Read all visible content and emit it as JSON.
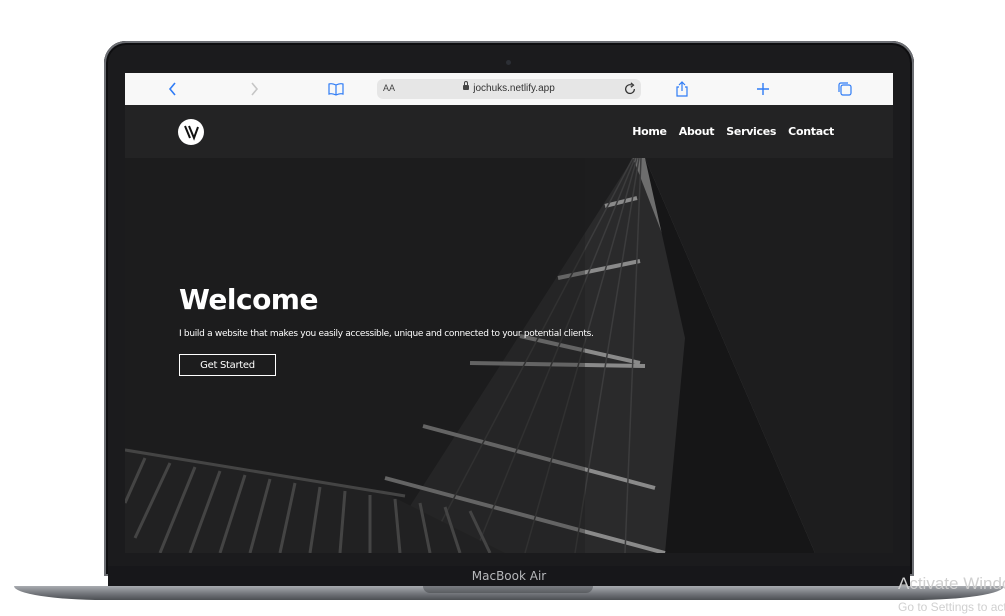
{
  "device": {
    "model_label": "MacBook Air"
  },
  "browser": {
    "address_aa": "AA",
    "url": "jochuks.netlify.app",
    "icons": {
      "back": "chevron-left-icon",
      "forward": "chevron-right-icon",
      "bookmarks": "book-icon",
      "reload": "reload-icon",
      "share": "share-icon",
      "new_tab": "plus-icon",
      "tabs": "tabs-icon"
    },
    "accent": "#2f7cf6"
  },
  "site": {
    "nav": {
      "items": [
        {
          "label": "Home"
        },
        {
          "label": "About"
        },
        {
          "label": "Services"
        },
        {
          "label": "Contact"
        }
      ]
    },
    "hero": {
      "title": "Welcome",
      "text": "I build a website that makes you easily accessible, unique and connected to your potential clients.",
      "cta": "Get Started"
    },
    "colors": {
      "background": "#1f1f20",
      "text": "#ffffff"
    }
  },
  "watermark": {
    "line1": "Activate Windows",
    "line2": "Go to Settings to activate Windows."
  }
}
